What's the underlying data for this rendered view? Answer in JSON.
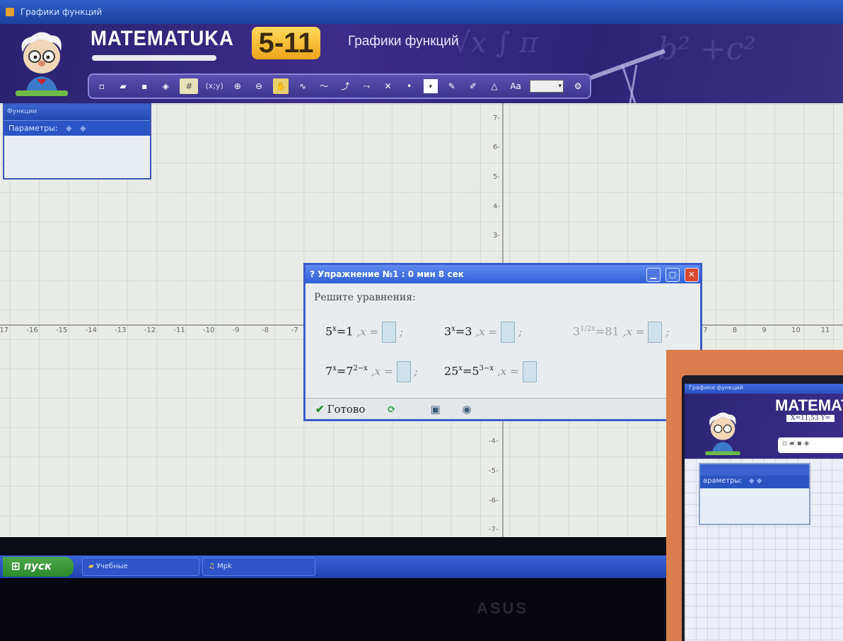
{
  "window": {
    "title": "Графики функций"
  },
  "header": {
    "logo_word": "MATEMATUKA",
    "logo_grades": "5-11",
    "section_title": "Графики функций"
  },
  "toolbar": {
    "icons": [
      "new-file-icon",
      "open-folder-icon",
      "save-icon",
      "eraser-icon",
      "grid-icon",
      "coordinates-icon",
      "zoom-in-icon",
      "zoom-out-icon",
      "hand-icon",
      "function-icon",
      "curve-icon",
      "tangent-icon",
      "derivative-icon",
      "delete-graph-icon",
      "point-icon",
      "dropdown-icon",
      "pencil-icon",
      "marker-icon",
      "triangle-icon",
      "text-icon",
      "line-style-icon",
      "settings-icon"
    ],
    "xy_label": "(x;y)",
    "text_label": "Aa",
    "accent_color": "#3e3590"
  },
  "functions_panel": {
    "title": "Функции",
    "params_label": "Параметры:"
  },
  "axes": {
    "x_ticks": [
      "-17",
      "-16",
      "-15",
      "-14",
      "-13",
      "-12",
      "-11",
      "-10",
      "-9",
      "-8",
      "-7",
      "7",
      "8",
      "9",
      "10",
      "11"
    ],
    "y_ticks": [
      "7",
      "6",
      "5",
      "4",
      "3",
      "-4",
      "-5",
      "-6",
      "-7"
    ]
  },
  "exercise": {
    "title": "Упражнение №1 : 0 мин  8 сек",
    "prompt": "Решите уравнения:",
    "x_label": ",x =",
    "equations": [
      {
        "base": "5",
        "exp": "x",
        "rhs": "=1",
        "sep": ";"
      },
      {
        "base": "3",
        "exp": "x",
        "rhs": "=3",
        "sep": ";"
      },
      {
        "base": "3",
        "exp": "1/2x",
        "rhs": "=81",
        "sep": ";"
      },
      {
        "base": "7",
        "exp": "x",
        "rhs_base": "=7",
        "rhs_exp": "2−x",
        "sep": ";"
      },
      {
        "base": "25",
        "exp": "x",
        "rhs_base": "=5",
        "rhs_exp": "3−x",
        "sep": ""
      }
    ],
    "done_label": "Готово",
    "buttons": [
      "refresh-icon",
      "monitor-icon",
      "eye-icon"
    ]
  },
  "taskbar": {
    "start_label": "пуск",
    "tasks": [
      "Учебные",
      "Mpk"
    ]
  },
  "inset": {
    "title": "Графики функций",
    "logo": "MATEMAT",
    "coords": "X=11,53   Y=",
    "params_label": "араметры:"
  },
  "monitor": {
    "brand": "ASUS"
  }
}
